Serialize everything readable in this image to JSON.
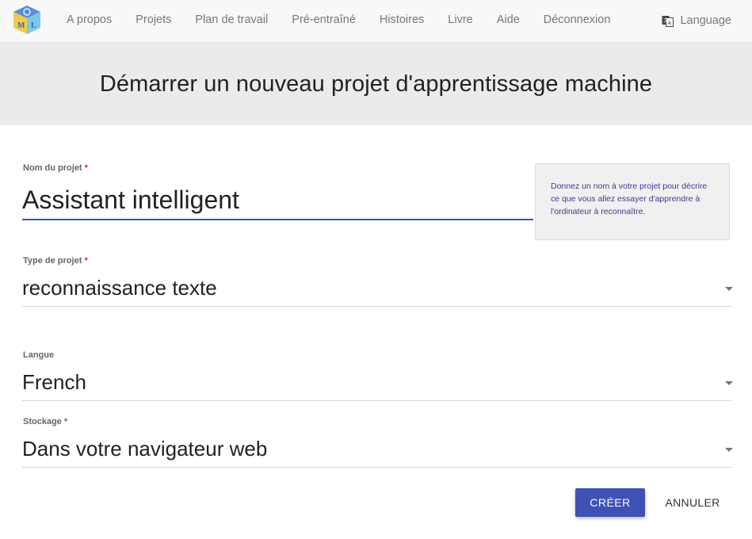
{
  "app": {
    "logo_letters": "ML"
  },
  "nav": {
    "links": [
      "A propos",
      "Projets",
      "Plan de travail",
      "Pré-entraîné",
      "Histoires",
      "Livre",
      "Aide",
      "Déconnexion"
    ],
    "language_label": "Language"
  },
  "page": {
    "title": "Démarrer un nouveau projet d'apprentissage machine"
  },
  "form": {
    "name": {
      "label": "Nom du projet",
      "required_mark": "*",
      "value": "Assistant intelligent"
    },
    "hint": "Donnez un nom à votre projet pour décrire ce que vous allez essayer d'apprendre à l'ordinateur à reconnaître.",
    "type": {
      "label": "Type de projet",
      "required_mark": "*",
      "value": "reconnaissance texte"
    },
    "language": {
      "label": "Langue",
      "value": "French"
    },
    "storage": {
      "label": "Stockage",
      "required_mark": "*",
      "value": "Dans votre navigateur web"
    },
    "create_label": "CRÉER",
    "cancel_label": "ANNULER"
  },
  "colors": {
    "primary": "#3f51b5",
    "navbar_bg": "#f8f8f8",
    "hero_bg": "#ebebeb"
  }
}
